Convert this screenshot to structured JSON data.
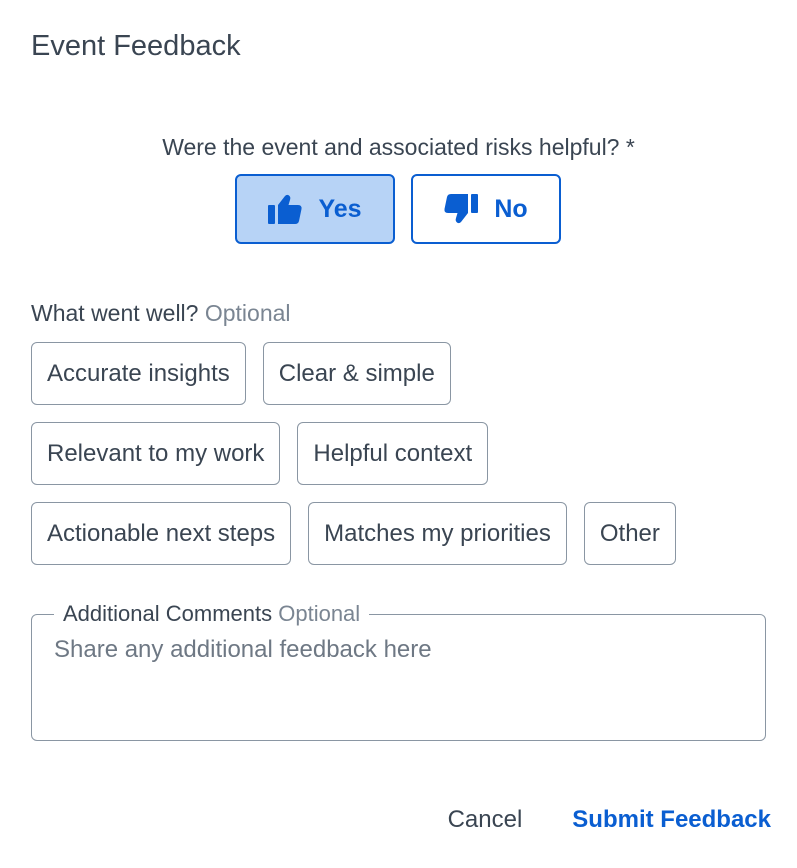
{
  "dialog": {
    "title": "Event Feedback"
  },
  "question": {
    "text": "Were the event and associated risks helpful? *",
    "selected": "yes",
    "options": [
      {
        "key": "yes",
        "label": "Yes",
        "icon": "thumbs-up-icon"
      },
      {
        "key": "no",
        "label": "No",
        "icon": "thumbs-down-icon"
      }
    ]
  },
  "went_well": {
    "label": "What went well?",
    "optional_label": "Optional",
    "chips": [
      "Accurate insights",
      "Clear & simple",
      "Relevant to my work",
      "Helpful context",
      "Actionable next steps",
      "Matches my priorities",
      "Other"
    ]
  },
  "comments": {
    "label": "Additional Comments",
    "optional_label": "Optional",
    "placeholder": "Share any additional feedback here",
    "value": ""
  },
  "actions": {
    "cancel_label": "Cancel",
    "submit_label": "Submit Feedback"
  },
  "colors": {
    "accent": "#0a5ed1",
    "selected_fill": "#b7d3f6",
    "text": "#3a4552",
    "muted": "#7a8592",
    "border": "#8a96a3"
  }
}
